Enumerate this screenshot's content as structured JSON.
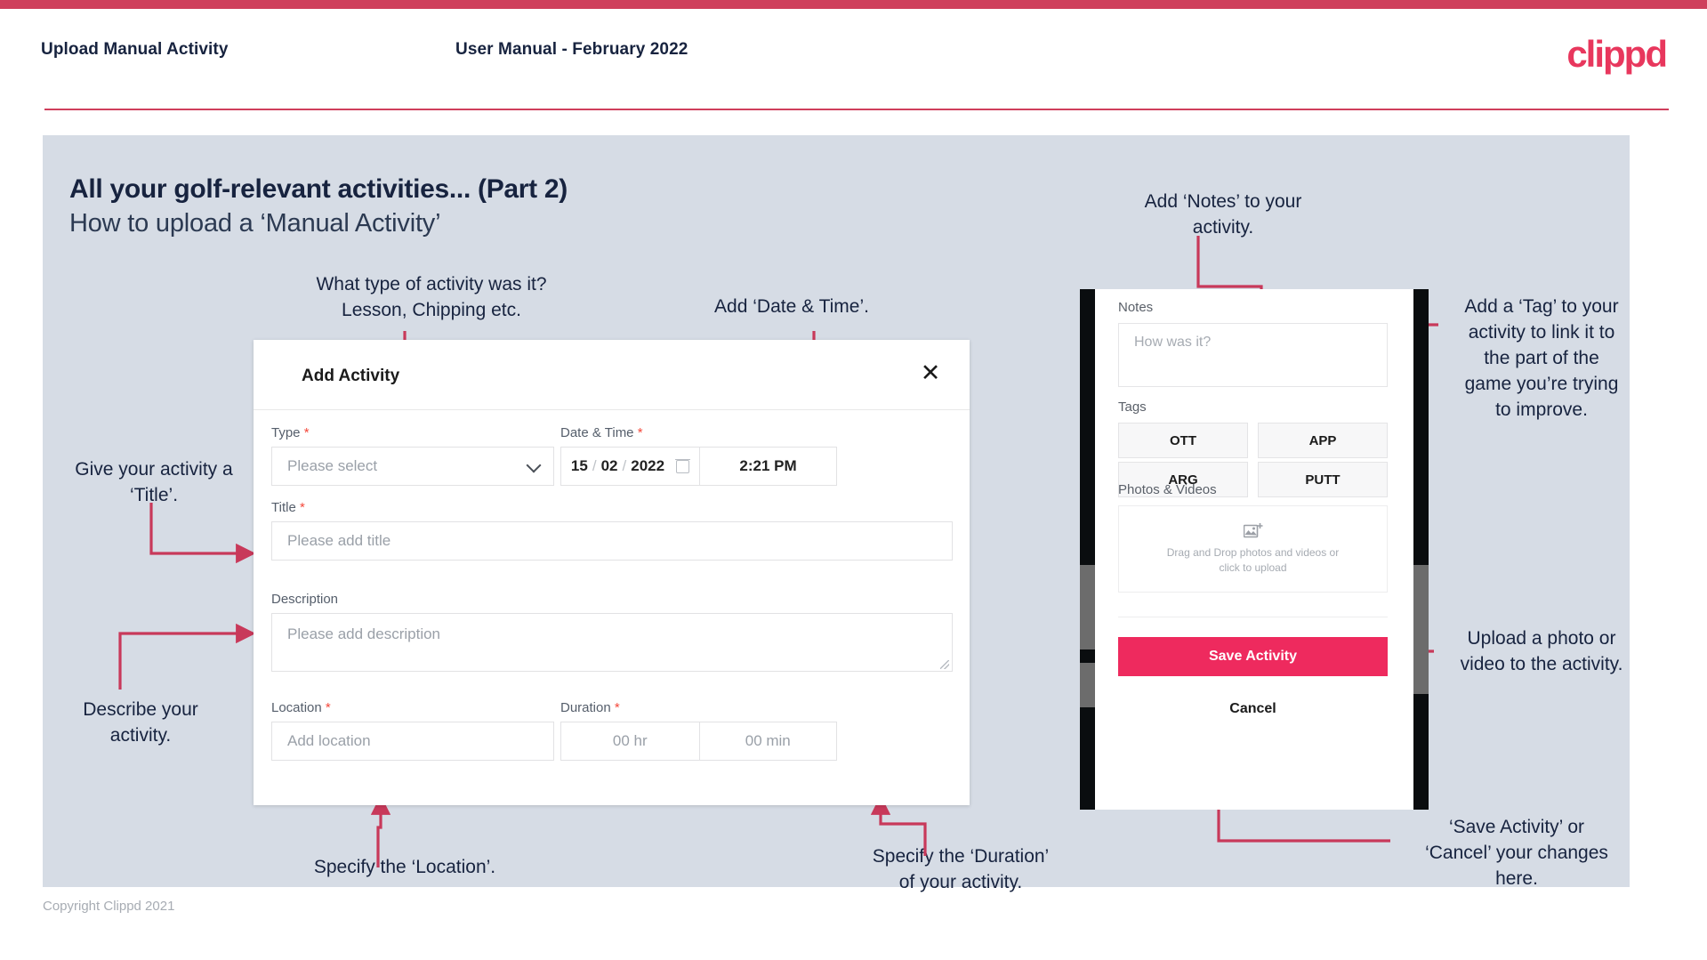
{
  "header": {
    "title": "Upload Manual Activity",
    "subtitle": "User Manual - February 2022",
    "logo": "clippd"
  },
  "slide": {
    "title": "All your golf-relevant activities... (Part 2)",
    "subtitle": "How to upload a ‘Manual Activity’"
  },
  "annotations": {
    "type": "What type of activity was it?\nLesson, Chipping etc.",
    "datetime": "Add ‘Date & Time’.",
    "title": "Give your activity a\n‘Title’.",
    "description": "Describe your\nactivity.",
    "location": "Specify the ‘Location’.",
    "duration": "Specify the ‘Duration’\nof your activity.",
    "notes": "Add ‘Notes’ to your\nactivity.",
    "tags": "Add a ‘Tag’ to your\nactivity to link it to\nthe part of the\ngame you’re trying\nto improve.",
    "upload": "Upload a photo or\nvideo to the activity.",
    "save_cancel": "‘Save Activity’ or\n‘Cancel’ your changes\nhere."
  },
  "dialog": {
    "title": "Add Activity",
    "close_icon": "close-icon",
    "fields": {
      "type": {
        "label": "Type",
        "required": "*",
        "placeholder": "Please select",
        "icon": "chevron-down-icon"
      },
      "datetime": {
        "label": "Date & Time",
        "required": "*",
        "day": "15",
        "month": "02",
        "year": "2022",
        "sep": "/",
        "time": "2:21 PM",
        "icon": "calendar-icon"
      },
      "title": {
        "label": "Title",
        "required": "*",
        "placeholder": "Please add title"
      },
      "description": {
        "label": "Description",
        "required": "",
        "placeholder": "Please add description"
      },
      "location": {
        "label": "Location",
        "required": "*",
        "placeholder": "Add location"
      },
      "duration": {
        "label": "Duration",
        "required": "*",
        "hours": "00 hr",
        "minutes": "00 min"
      }
    }
  },
  "phone": {
    "notes": {
      "label": "Notes",
      "placeholder": "How was it?"
    },
    "tags": {
      "label": "Tags",
      "items": [
        "OTT",
        "APP",
        "ARG",
        "PUTT"
      ]
    },
    "photos": {
      "label": "Photos & Videos",
      "icon": "add-image-icon",
      "text": "Drag and Drop photos and videos or\nclick to upload"
    },
    "save_label": "Save Activity",
    "cancel_label": "Cancel"
  },
  "footer": {
    "copyright": "Copyright Clippd 2021"
  },
  "colors": {
    "accent": "#ee2a5e",
    "bar": "#cf3f5c",
    "arrow": "#c8395a",
    "panel": "#d6dce5",
    "text_dark": "#17233f"
  }
}
